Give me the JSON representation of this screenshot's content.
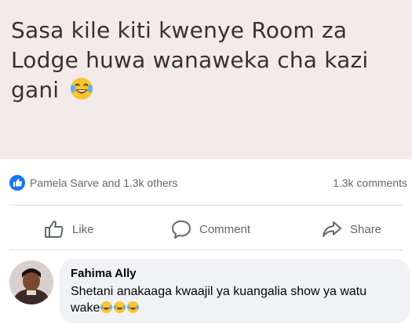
{
  "post": {
    "text": "Sasa kile kiti kwenye Room za Lodge huwa wanaweka cha kazi gani",
    "emoji": "laughing-crying-emoji"
  },
  "reactions": {
    "summary": "Pamela Sarve and 1.3k others",
    "comments_count": "1.3k comments"
  },
  "actions": {
    "like_label": "Like",
    "comment_label": "Comment",
    "share_label": "Share"
  },
  "comment": {
    "author": "Fahima Ally",
    "text": "Shetani anakaaga kwaajil ya kuangalia show ya watu wake"
  },
  "colors": {
    "like_blue": "#1877f2",
    "muted_text": "#65676b",
    "bubble_bg": "#f0f2f5"
  }
}
